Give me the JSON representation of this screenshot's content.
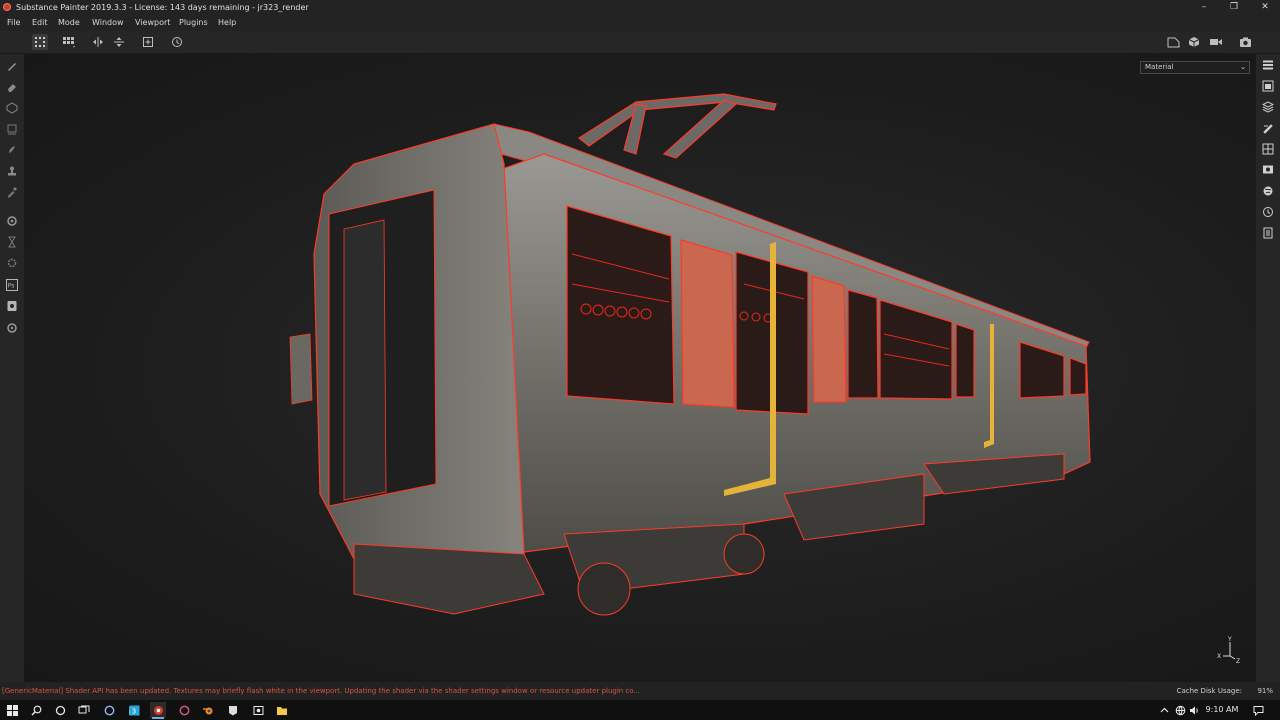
{
  "window": {
    "title": "Substance Painter 2019.3.3 - License: 143 days remaining - jr323_render",
    "minimize": "–",
    "maximize": "❐",
    "close": "✕"
  },
  "menu": {
    "items": [
      "File",
      "Edit",
      "Mode",
      "Window",
      "Viewport",
      "Plugins",
      "Help"
    ]
  },
  "viewport": {
    "display_channel": "Material",
    "axis": {
      "y": "Y",
      "x": "X",
      "z": "Z"
    }
  },
  "status": {
    "message": "[GenericMaterial] Shader API has been updated. Textures may briefly flash white in the viewport. Updating the shader via the shader settings window or resource updater plugin co...",
    "cache_label": "Cache Disk Usage:",
    "cache_value": "91%"
  },
  "taskbar": {
    "time": "9:10 AM"
  },
  "colors": {
    "accent": "#d9553d",
    "wire": "#ff2a1a",
    "panel": "#262626",
    "window": "#232323"
  }
}
